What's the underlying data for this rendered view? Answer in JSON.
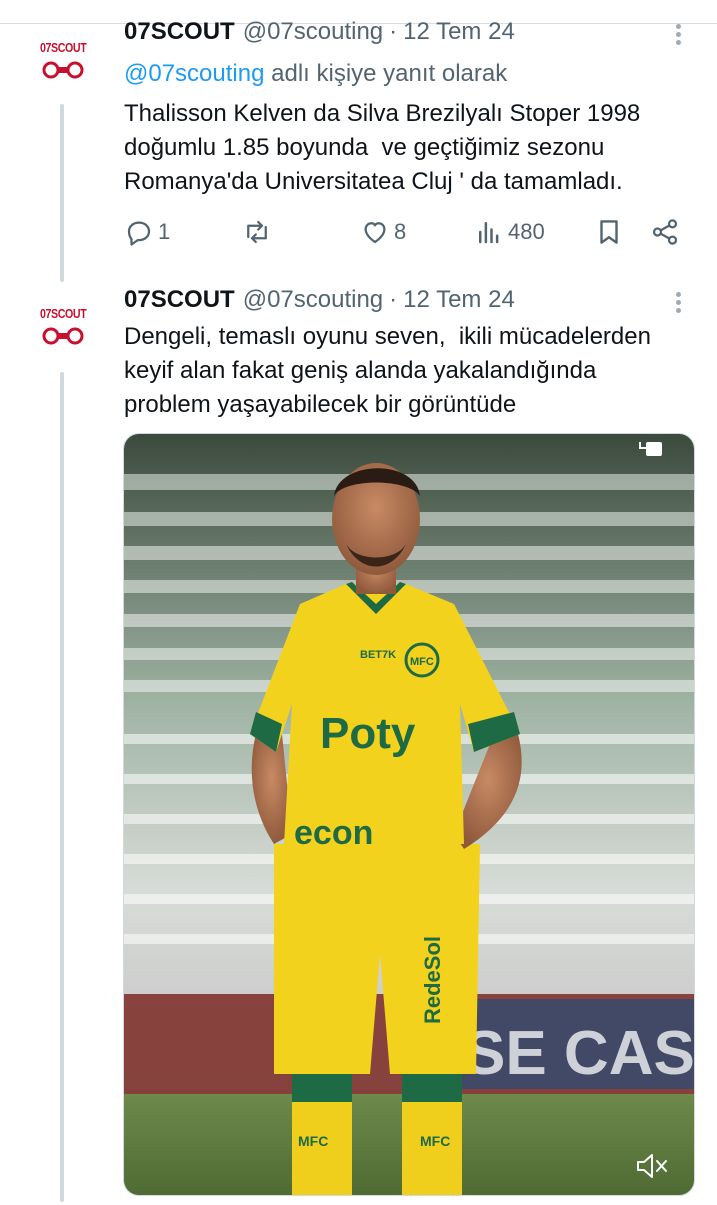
{
  "tweets": [
    {
      "avatar_logo": "07SCOUT",
      "name": "07SCOUT",
      "handle": "@07scouting",
      "separator": "·",
      "date": "12 Tem 24",
      "reply_mention": "@07scouting",
      "reply_suffix": "adlı kişiye yanıt olarak",
      "body_lines": [
        "Thalisson Kelven da Silva Brezilyalı Stoper 1998",
        "doğumlu 1.85 boyunda  ve geçtiğimiz sezonu",
        "Romanya'da Universitatea Cluj ' da tamamladı."
      ],
      "actions": {
        "replies": "1",
        "retweets": "",
        "likes": "8",
        "views": "480"
      }
    },
    {
      "avatar_logo": "07SCOUT",
      "name": "07SCOUT",
      "handle": "@07scouting",
      "separator": "·",
      "date": "12 Tem 24",
      "body_lines": [
        "Dengeli, temaslı oyunu seven,  ikili mücadelerden",
        "keyif alan fakat geniş alanda yakalandığında",
        "problem yaşayabilecek bir görüntüde"
      ],
      "media": {
        "type": "video",
        "shirt_sponsor": "Poty",
        "shorts_sponsor": "RedeSol",
        "crest": "MFC",
        "sleeve_logo": "BET7K",
        "chest_sponsor_lower": "econ",
        "ad_board": "SE CAS",
        "sock_text": "MFC"
      }
    }
  ],
  "icons": {
    "more": "more-vertical-icon",
    "reply": "reply-icon",
    "retweet": "retweet-icon",
    "like": "heart-icon",
    "views": "views-icon",
    "bookmark": "bookmark-icon",
    "share": "share-icon",
    "mute": "volume-mute-icon",
    "gif": "gif-icon"
  },
  "colors": {
    "brand_red": "#c8102e",
    "link_blue": "#1d9bf0",
    "muted_text": "#536471",
    "jersey_yellow": "#f3d21d",
    "jersey_green": "#1e6a45"
  }
}
